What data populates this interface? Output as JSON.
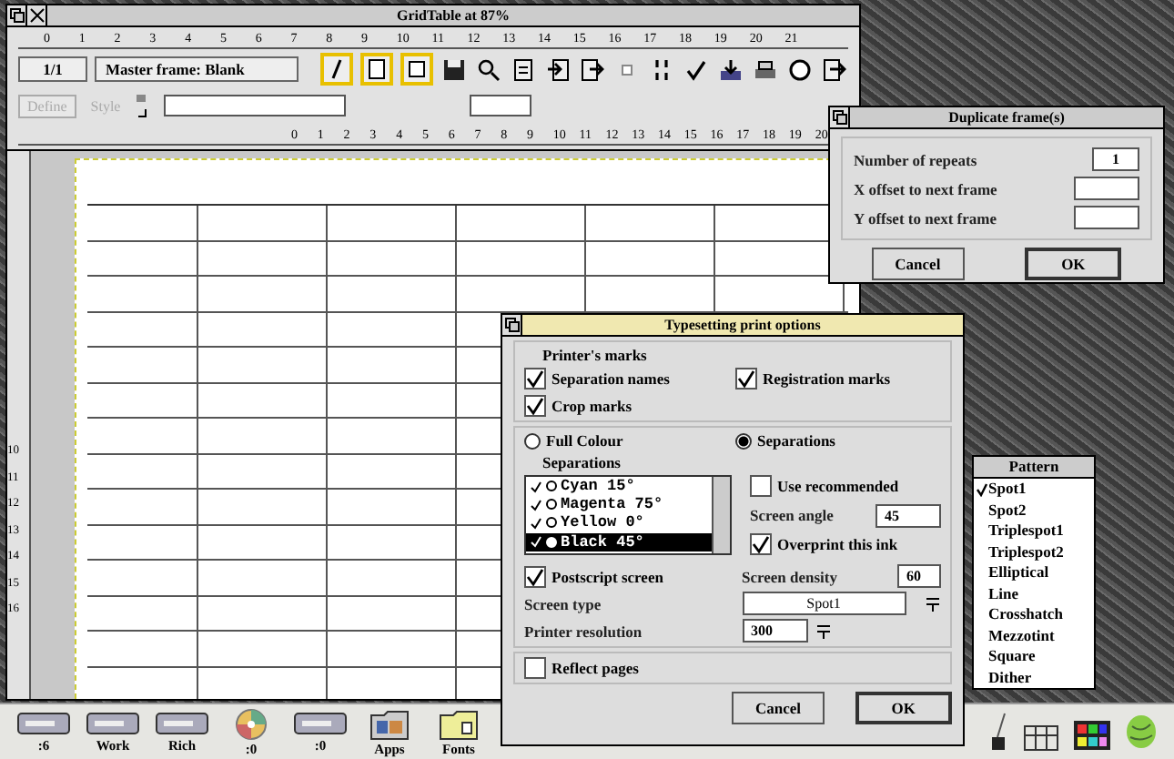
{
  "main_window": {
    "title": "GridTable at 87%",
    "top_ruler": [
      "0",
      "1",
      "2",
      "3",
      "4",
      "5",
      "6",
      "7",
      "8",
      "9",
      "10",
      "11",
      "12",
      "13",
      "14",
      "15",
      "16",
      "17",
      "18",
      "19",
      "20",
      "21"
    ],
    "page_indicator": "1/1",
    "master_frame": "Master frame: Blank",
    "define_button": {
      "label": "Define",
      "disabled": true
    },
    "style_label": {
      "label": "Style",
      "disabled": true
    },
    "bottom_ruler": [
      "0",
      "1",
      "2",
      "3",
      "4",
      "5",
      "6",
      "7",
      "8",
      "9",
      "10",
      "11",
      "12",
      "13",
      "14",
      "15",
      "16",
      "17",
      "18",
      "19",
      "20"
    ],
    "side_ruler": [
      "10",
      "11",
      "12",
      "13",
      "14",
      "15",
      "16"
    ]
  },
  "duplicate_dialog": {
    "title": "Duplicate frame(s)",
    "fields": [
      {
        "label": "Number of repeats",
        "value": "1"
      },
      {
        "label": "X offset to next frame"
      },
      {
        "label": "Y offset to next frame"
      }
    ],
    "buttons": [
      {
        "label": "Cancel",
        "default": false
      },
      {
        "label": "OK",
        "default": true
      }
    ]
  },
  "print_dialog": {
    "title": "Typesetting print options",
    "marks_heading": "Printer's marks",
    "marks": [
      {
        "label": "Separation names",
        "checked": true
      },
      {
        "label": "Registration marks",
        "checked": true
      },
      {
        "label": "Crop marks",
        "checked": true
      }
    ],
    "modes": [
      {
        "label": "Full Colour",
        "selected": false
      },
      {
        "label": "Separations",
        "selected": true
      }
    ],
    "separations_heading": "Separations",
    "separations": [
      {
        "label": "Cyan 15°",
        "enabled": true,
        "selected": false
      },
      {
        "label": "Magenta 75°",
        "enabled": true,
        "selected": false
      },
      {
        "label": "Yellow 0°",
        "enabled": true,
        "selected": false
      },
      {
        "label": "Black 45°",
        "enabled": true,
        "selected": true
      }
    ],
    "use_recommended": {
      "label": "Use recommended",
      "checked": false
    },
    "screen_angle": {
      "label": "Screen angle",
      "value": "45"
    },
    "overprint": {
      "label": "Overprint this ink",
      "checked": true
    },
    "postscript_screen": {
      "label": "Postscript screen",
      "checked": true
    },
    "screen_density": {
      "label": "Screen density",
      "value": "60"
    },
    "screen_type": {
      "label": "Screen type",
      "value": "Spot1"
    },
    "printer_resolution": {
      "label": "Printer resolution",
      "value": "300"
    },
    "reflect_pages": {
      "label": "Reflect pages",
      "checked": false
    },
    "buttons": [
      {
        "label": "Cancel",
        "default": false
      },
      {
        "label": "OK",
        "default": true
      }
    ]
  },
  "pattern_menu": {
    "title": "Pattern",
    "items": [
      {
        "label": "Spot1",
        "checked": true
      },
      {
        "label": "Spot2",
        "checked": false
      },
      {
        "label": "Triplespot1",
        "checked": false
      },
      {
        "label": "Triplespot2",
        "checked": false
      },
      {
        "label": "Elliptical",
        "checked": false
      },
      {
        "label": "Line",
        "checked": false
      },
      {
        "label": "Crosshatch",
        "checked": false
      },
      {
        "label": "Mezzotint",
        "checked": false
      },
      {
        "label": "Square",
        "checked": false
      },
      {
        "label": "Dither",
        "checked": false
      }
    ]
  },
  "icon_bar": [
    {
      "kind": "drive",
      "label": ":6"
    },
    {
      "kind": "drive",
      "label": "Work"
    },
    {
      "kind": "drive",
      "label": "Rich"
    },
    {
      "kind": "disc",
      "label": ":0"
    },
    {
      "kind": "drive",
      "label": ":0"
    },
    {
      "kind": "apps",
      "label": "Apps"
    },
    {
      "kind": "folder",
      "label": "Fonts"
    }
  ]
}
